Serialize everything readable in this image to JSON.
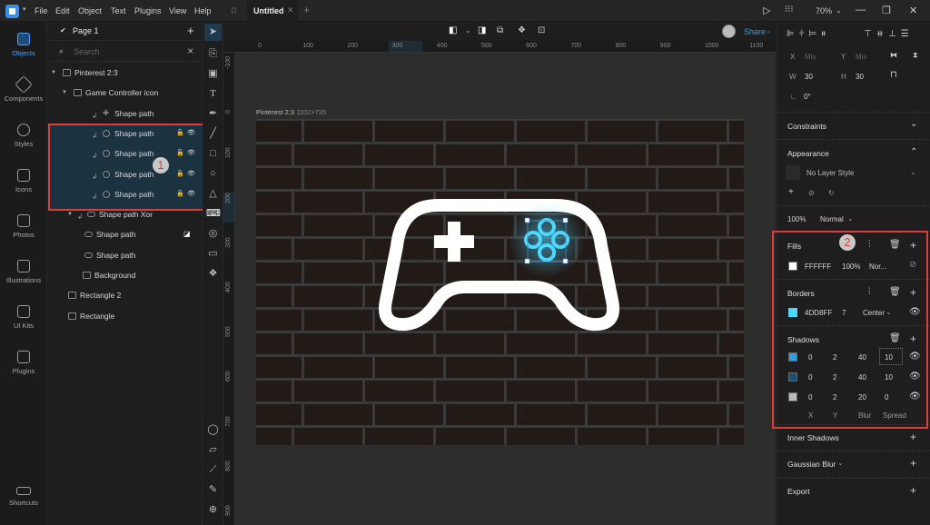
{
  "titlebar": {
    "menu": [
      "File",
      "Edit",
      "Object",
      "Text",
      "Plugins",
      "View",
      "Help"
    ],
    "tab_title": "Untitled",
    "zoom": "70%"
  },
  "toolbar": {
    "share_label": "Share"
  },
  "left_rail": [
    {
      "label": "Objects",
      "active": true
    },
    {
      "label": "Components"
    },
    {
      "label": "Styles"
    },
    {
      "label": "Icons"
    },
    {
      "label": "Photos"
    },
    {
      "label": "Illustrations"
    },
    {
      "label": "UI Kits"
    },
    {
      "label": "Plugins"
    },
    {
      "label": "Shortcuts"
    }
  ],
  "layers": {
    "page": "Page 1",
    "search_placeholder": "Search",
    "items": [
      {
        "label": "Pinterest 2:3"
      },
      {
        "label": "Game Controller icon"
      },
      {
        "label": "Shape path"
      },
      {
        "label": "Shape path",
        "selected": true
      },
      {
        "label": "Shape path",
        "selected": true
      },
      {
        "label": "Shape path",
        "selected": true
      },
      {
        "label": "Shape path",
        "selected": true
      },
      {
        "label": "Shape path Xor"
      },
      {
        "label": "Shape path"
      },
      {
        "label": "Shape path"
      },
      {
        "label": "Background"
      },
      {
        "label": "Rectangle 2"
      },
      {
        "label": "Rectangle"
      }
    ],
    "badge": "1"
  },
  "rulers": {
    "h": [
      "0",
      "100",
      "200",
      "300",
      "400",
      "500",
      "600",
      "700",
      "800",
      "900",
      "1000",
      "1100"
    ],
    "v": [
      "-100",
      "0",
      "100",
      "200",
      "300",
      "400",
      "500",
      "600",
      "700",
      "800",
      "900"
    ]
  },
  "artboard": {
    "name": "Pinterest 2:3",
    "size": "1102×735"
  },
  "colors": {
    "accent": "#4DD8FF",
    "highlight": "#E23B3B",
    "brick": "#221A17",
    "mortar": "#3A3A3A"
  },
  "inspector": {
    "x_label": "X",
    "x_value": "Mix",
    "y_label": "Y",
    "y_value": "Mix",
    "w_label": "W",
    "w_value": "30",
    "h_label": "H",
    "h_value": "30",
    "rotation": "0°",
    "constraints": "Constraints",
    "appearance": "Appearance",
    "layer_style": "No Layer Style",
    "opacity": "100%",
    "blend": "Normal",
    "fills_title": "Fills",
    "fill": {
      "hex": "FFFFFF",
      "opacity": "100%",
      "blend": "Nor..."
    },
    "borders_title": "Borders",
    "border": {
      "hex": "4DD8FF",
      "width": "7",
      "position": "Center"
    },
    "shadows_title": "Shadows",
    "shadows": [
      {
        "x": "0",
        "y": "2",
        "blur": "40",
        "spread": "10"
      },
      {
        "x": "0",
        "y": "2",
        "blur": "40",
        "spread": "10"
      },
      {
        "x": "0",
        "y": "2",
        "blur": "20",
        "spread": "0"
      }
    ],
    "shadow_cols": [
      "X",
      "Y",
      "Blur",
      "Spread"
    ],
    "inner_shadows": "Inner Shadows",
    "gaussian_blur": "Gaussian Blur",
    "export": "Export",
    "badge": "2"
  }
}
